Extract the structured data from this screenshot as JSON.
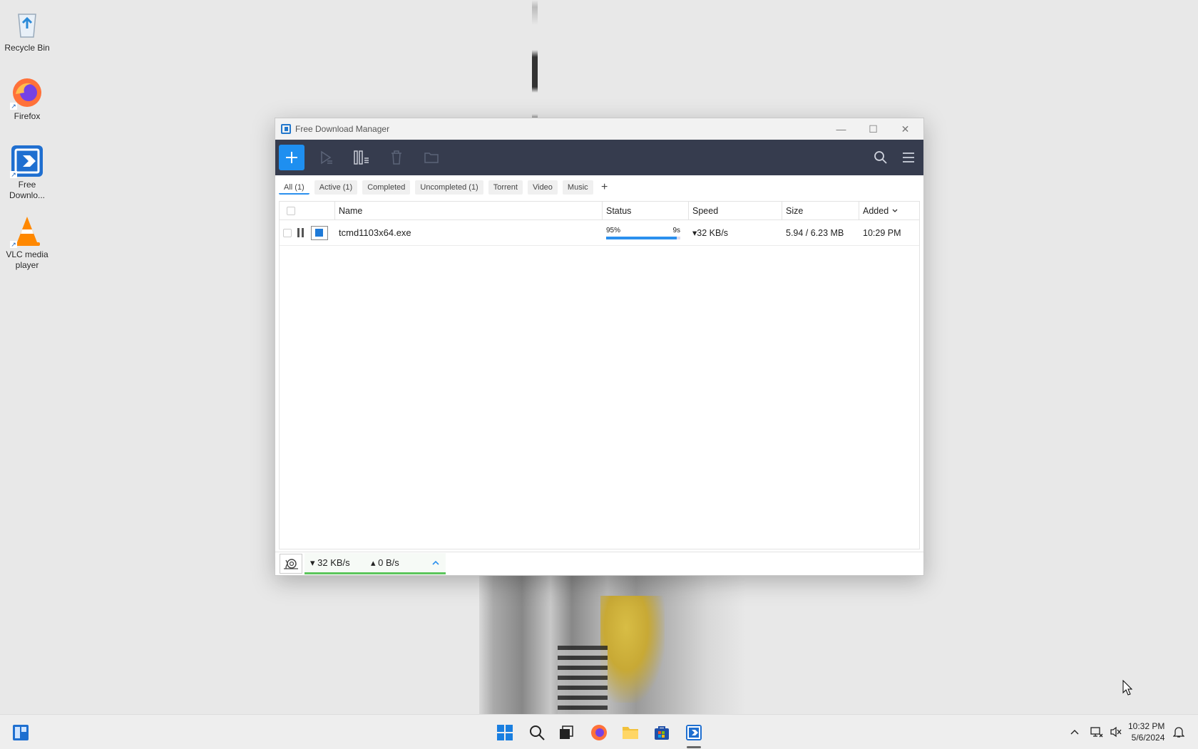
{
  "desktop": {
    "icons": [
      {
        "label": "Recycle Bin",
        "icon": "recycle-bin-icon"
      },
      {
        "label": "Firefox",
        "icon": "firefox-icon"
      },
      {
        "label": "Free Downlo...",
        "icon": "free-download-manager-icon"
      },
      {
        "label": "VLC media player",
        "icon": "vlc-icon"
      }
    ]
  },
  "window": {
    "title": "Free Download Manager",
    "controls": {
      "minimize": "—",
      "maximize": "☐",
      "close": "✕"
    }
  },
  "filters": [
    {
      "label": "All (1)",
      "active": true
    },
    {
      "label": "Active (1)",
      "active": false
    },
    {
      "label": "Completed",
      "active": false
    },
    {
      "label": "Uncompleted (1)",
      "active": false
    },
    {
      "label": "Torrent",
      "active": false
    },
    {
      "label": "Video",
      "active": false
    },
    {
      "label": "Music",
      "active": false
    }
  ],
  "table": {
    "columns": {
      "name": "Name",
      "status": "Status",
      "speed": "Speed",
      "size": "Size",
      "added": "Added"
    },
    "rows": [
      {
        "name": "tcmd1103x64.exe",
        "percent_label": "95%",
        "progress": 0.95,
        "eta": "9s",
        "speed": "▾32 KB/s",
        "size": "5.94 / 6.23 MB",
        "added": "10:29 PM"
      }
    ]
  },
  "bottombar": {
    "download_speed": "▾ 32 KB/s",
    "upload_speed": "▴ 0 B/s"
  },
  "taskbar": {
    "time": "10:32 PM",
    "date": "5/6/2024"
  },
  "colors": {
    "accent": "#1e8ff0",
    "toolbar_bg": "#363c4e",
    "speed_bar": "#5cc65c"
  }
}
